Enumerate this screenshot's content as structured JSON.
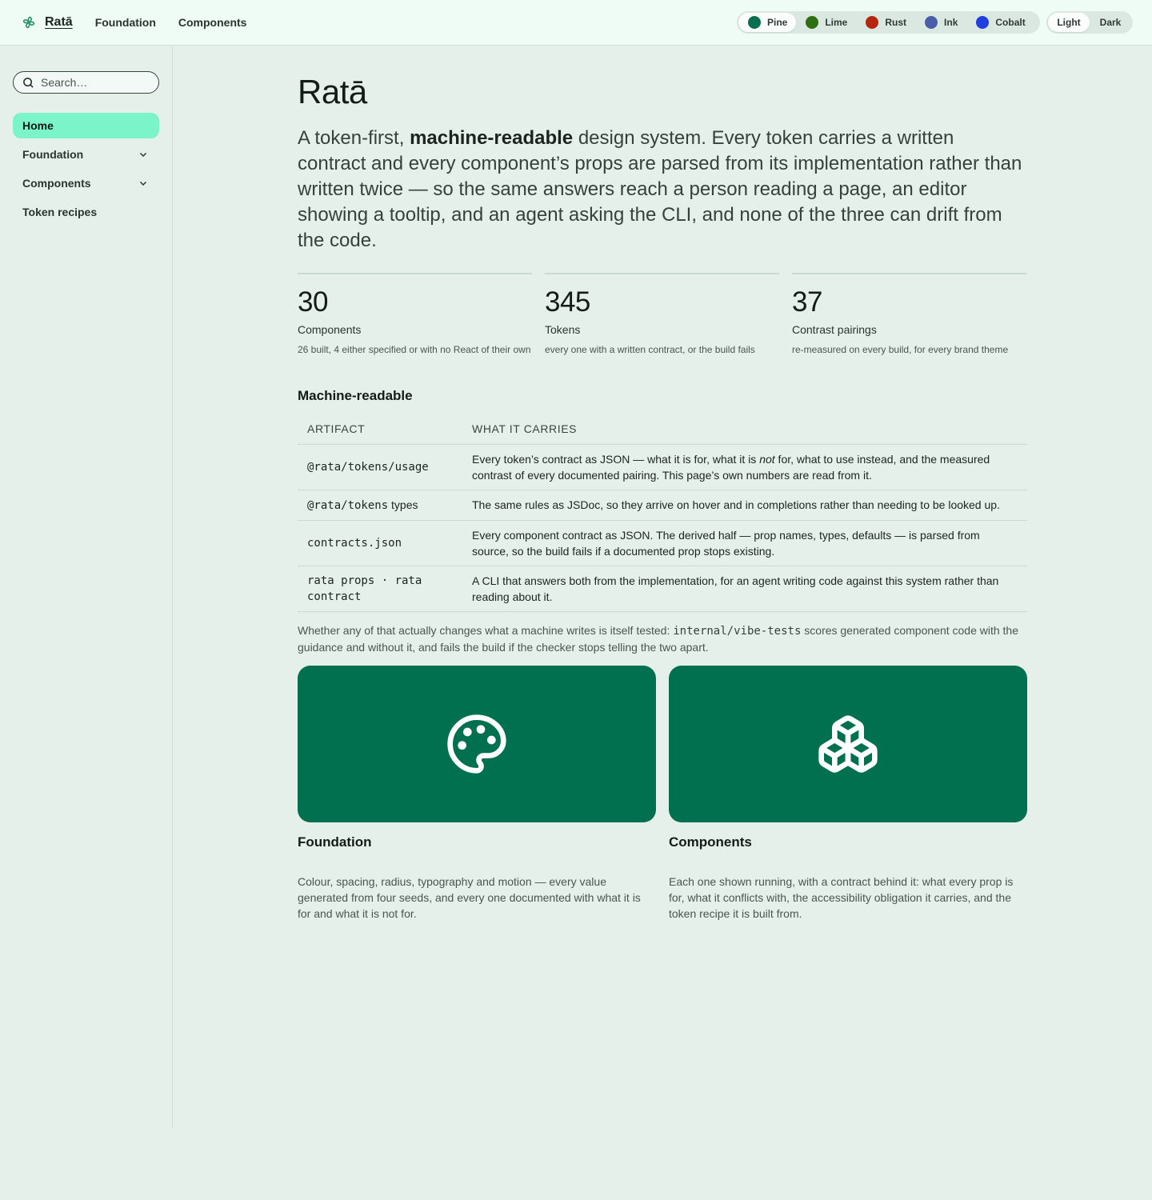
{
  "brand": {
    "name": "Ratā"
  },
  "topnav": [
    "Foundation",
    "Components"
  ],
  "themes": [
    {
      "label": "Pine",
      "color": "#0a6e4f",
      "active": true
    },
    {
      "label": "Lime",
      "color": "#2e6f12",
      "active": false
    },
    {
      "label": "Rust",
      "color": "#b5260e",
      "active": false
    },
    {
      "label": "Ink",
      "color": "#4a5ea8",
      "active": false
    },
    {
      "label": "Cobalt",
      "color": "#1f3fe0",
      "active": false
    }
  ],
  "modes": [
    {
      "label": "Light",
      "active": true
    },
    {
      "label": "Dark",
      "active": false
    }
  ],
  "search": {
    "placeholder": "Search…"
  },
  "sidebar": {
    "items": [
      {
        "label": "Home",
        "active": true,
        "expandable": false
      },
      {
        "label": "Foundation",
        "active": false,
        "expandable": true
      },
      {
        "label": "Components",
        "active": false,
        "expandable": true
      },
      {
        "label": "Token recipes",
        "active": false,
        "expandable": false
      }
    ]
  },
  "page": {
    "title": "Ratā",
    "lead_before": "A token-first, ",
    "lead_strong": "machine-readable",
    "lead_after": " design system. Every token carries a written contract and every component’s props are parsed from its implementation rather than written twice — so the same answers reach a person reading a page, an editor showing a tooltip, and an agent asking the CLI, and none of the three can drift from the code."
  },
  "stats": [
    {
      "value": "30",
      "label": "Components",
      "note": "26 built, 4 either specified or with no React of their own"
    },
    {
      "value": "345",
      "label": "Tokens",
      "note": "every one with a written contract, or the build fails"
    },
    {
      "value": "37",
      "label": "Contrast pairings",
      "note": "re-measured on every build, for every brand theme"
    }
  ],
  "machine": {
    "title": "Machine-readable",
    "headers": [
      "ARTIFACT",
      "WHAT IT CARRIES"
    ],
    "rows": [
      {
        "code": "@rata/tokens/usage",
        "suffix": "",
        "desc_before": "Every token’s contract as JSON — what it is for, what it is ",
        "desc_em": "not",
        "desc_after": " for, what to use instead, and the measured contrast of every documented pairing. This page’s own numbers are read from it."
      },
      {
        "code": "@rata/tokens",
        "suffix": " types",
        "desc_before": "The same rules as JSDoc, so they arrive on hover and in completions rather than needing to be looked up.",
        "desc_em": "",
        "desc_after": ""
      },
      {
        "code": "contracts.json",
        "suffix": "",
        "desc_before": "Every component contract as JSON. The derived half — prop names, types, defaults — is parsed from source, so the build fails if a documented prop stops existing.",
        "desc_em": "",
        "desc_after": ""
      },
      {
        "code": "rata props · rata contract",
        "suffix": "",
        "desc_before": "A CLI that answers both from the implementation, for an agent writing code against this system rather than reading about it.",
        "desc_em": "",
        "desc_after": ""
      }
    ],
    "footnote_before": "Whether any of that actually changes what a machine writes is itself tested: ",
    "footnote_code": "internal/vibe-tests",
    "footnote_after": " scores generated component code with the guidance and without it, and fails the build if the checker stops telling the two apart."
  },
  "cards": [
    {
      "title": "Foundation",
      "icon": "palette-icon",
      "desc": "Colour, spacing, radius, typography and motion — every value generated from four seeds, and every one documented with what it is for and what it is not for."
    },
    {
      "title": "Components",
      "icon": "blocks-icon",
      "desc": "Each one shown running, with a contract behind it: what every prop is for, what it conflicts with, the accessibility obligation it carries, and the token recipe it is built from."
    }
  ],
  "colors": {
    "accent": "#00704f",
    "active_nav": "#7cf4c9",
    "background": "#e6f0ea"
  }
}
